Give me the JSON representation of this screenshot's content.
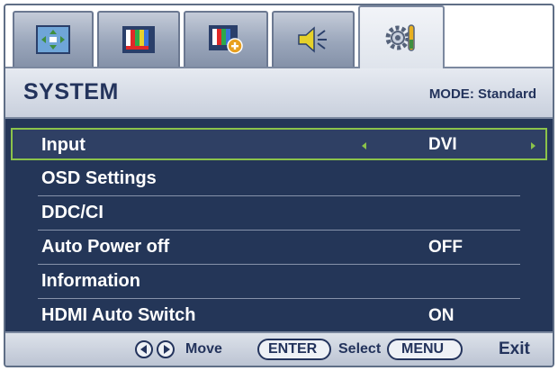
{
  "tabs": [
    {
      "icon": "display-position-icon",
      "active": false
    },
    {
      "icon": "picture-bars-icon",
      "active": false
    },
    {
      "icon": "picture-advanced-icon",
      "active": false
    },
    {
      "icon": "speaker-audio-icon",
      "active": false
    },
    {
      "icon": "system-gear-wrench-icon",
      "active": true
    }
  ],
  "header": {
    "title": "SYSTEM",
    "mode": "MODE: Standard"
  },
  "menu": {
    "items": [
      {
        "label": "Input",
        "value": "DVI",
        "selected": true
      },
      {
        "label": "OSD Settings",
        "value": ""
      },
      {
        "label": "DDC/CI",
        "value": ""
      },
      {
        "label": "Auto Power off",
        "value": "OFF"
      },
      {
        "label": "Information",
        "value": ""
      },
      {
        "label": "HDMI Auto Switch",
        "value": "ON"
      }
    ]
  },
  "footer": {
    "enter_label": "ENTER",
    "menu_label": "MENU",
    "select_label": "Select",
    "move_label": "Move",
    "exit_label": "Exit"
  },
  "colors": {
    "menu_bg": "#243658",
    "selection_border": "#8bc34a",
    "title_text": "#23335c"
  }
}
